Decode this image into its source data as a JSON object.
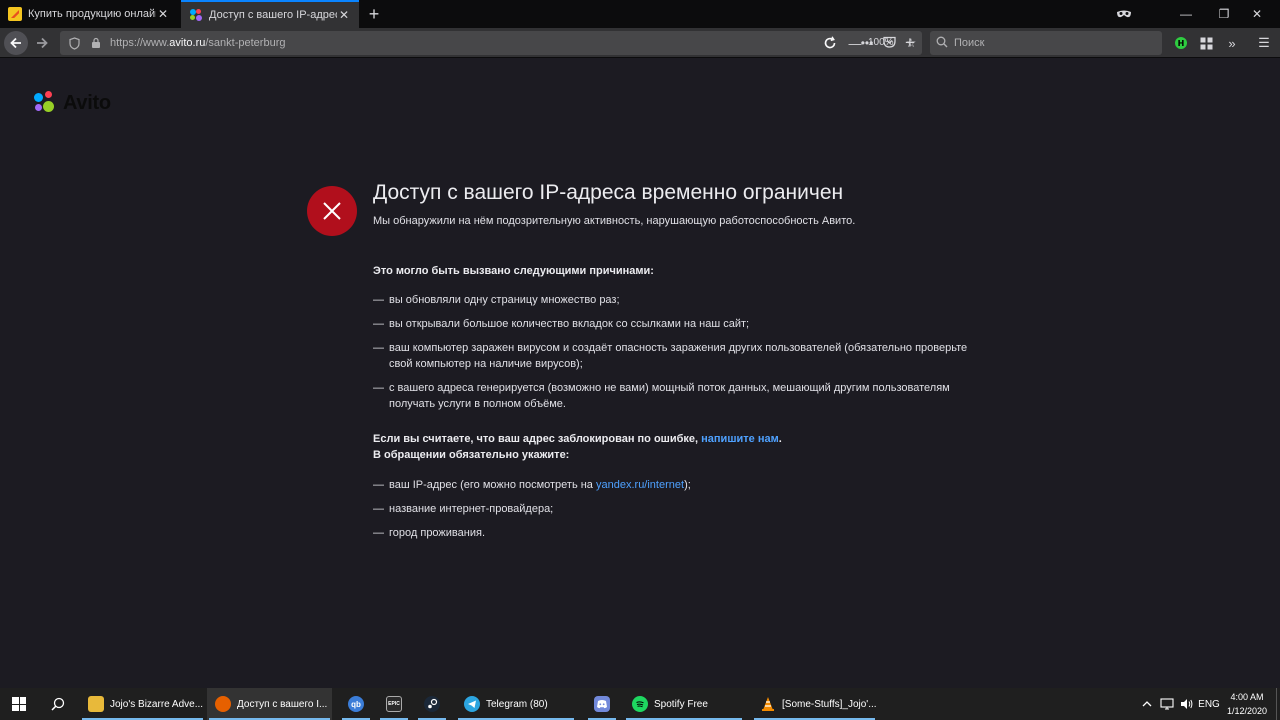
{
  "browser": {
    "tabs": [
      {
        "title": "Купить продукцию онлайн из",
        "active": false
      },
      {
        "title": "Доступ с вашего IP-адреса вр",
        "active": true
      }
    ],
    "url_prefix": "https://www.",
    "url_host": "avito.ru",
    "url_path": "/sankt-peterburg",
    "zoom": "100%",
    "search_placeholder": "Поиск",
    "accent_color": "#0a84ff"
  },
  "page": {
    "logo_text": "Avito",
    "headline": "Доступ с вашего IP-адреса временно ограничен",
    "subtitle": "Мы обнаружили на нём подозрительную активность, нарушающую работоспособность Авито.",
    "reasons_title": "Это могло быть вызвано следующими причинами:",
    "reasons": [
      "вы обновляли одну страницу множество раз;",
      "вы открывали большое количество вкладок со ссылками на наш сайт;",
      "ваш компьютер заражен вирусом и создаёт опасность заражения других пользователей (обязательно проверьте свой компьютер на наличие вирусов);",
      "с вашего адреса генерируется (возможно не вами) мощный поток данных, мешающий другим пользователям получать услуги в полном объёме."
    ],
    "contact_text": "Если вы считаете, что ваш адрес заблокирован по ошибке,",
    "contact_link": "напишите нам",
    "contact_end": ".",
    "contact_line2": "В обращении обязательно укажите:",
    "requirements_ip_prefix": "ваш IP-адрес (его можно посмотреть на",
    "requirements_ip_link": "yandex.ru/internet",
    "requirements_ip_suffix": ");",
    "requirements": [
      "название интернет-провайдера;",
      "город проживания."
    ],
    "dash": "—",
    "error_color": "#b10f1c",
    "link_color": "#4ea1ff"
  },
  "taskbar": {
    "apps": [
      {
        "label": "Jojo's Bizarre Adve...",
        "icon": "folder-icon"
      },
      {
        "label": "Доступ с вашего I...",
        "icon": "firefox-icon"
      },
      {
        "label": "",
        "icon": "qbittorrent-icon"
      },
      {
        "label": "",
        "icon": "epic-games-icon",
        "icon_text": "EPIC"
      },
      {
        "label": "",
        "icon": "steam-icon"
      },
      {
        "label": "Telegram (80)",
        "icon": "telegram-icon"
      },
      {
        "label": "",
        "icon": "discord-icon"
      },
      {
        "label": "Spotify Free",
        "icon": "spotify-icon"
      },
      {
        "label": "[Some-Stuffs]_Jojo'...",
        "icon": "vlc-icon"
      }
    ],
    "language": "ENG",
    "time": "4:00 AM",
    "date": "1/12/2020"
  }
}
